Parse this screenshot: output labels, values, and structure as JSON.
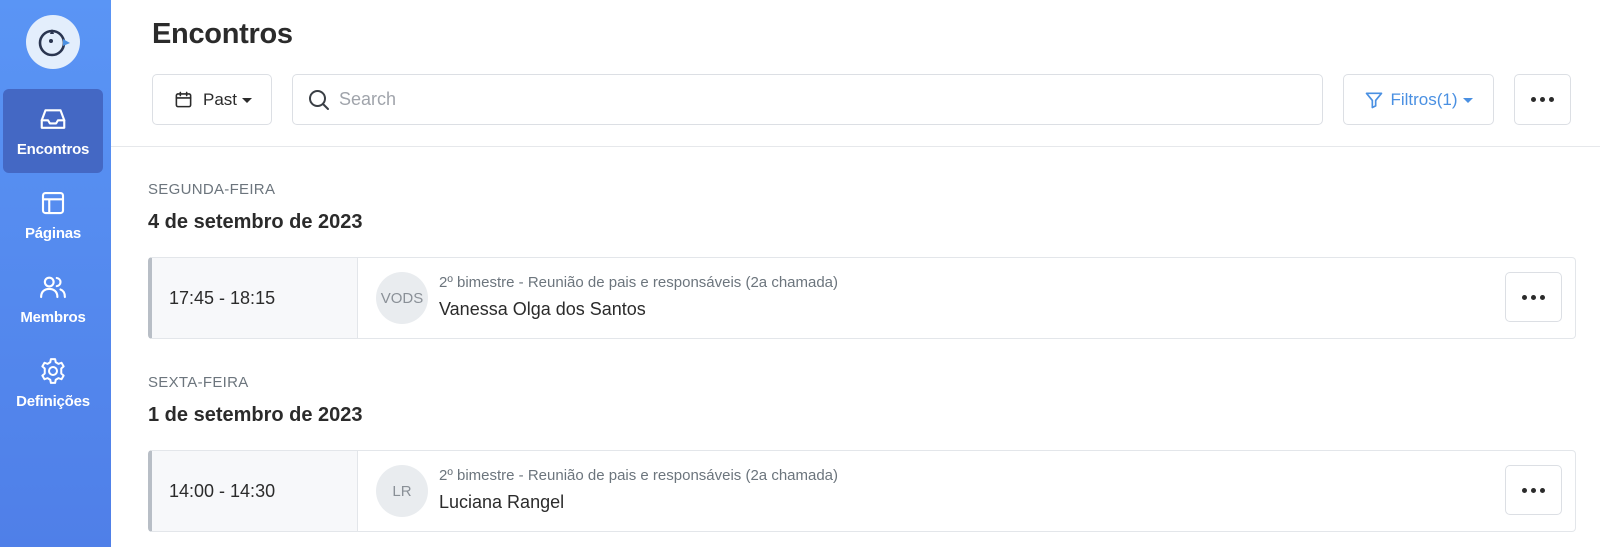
{
  "sidebar": {
    "logo_icon": "bird-logo-icon",
    "items": [
      {
        "label": "Encontros",
        "icon": "inbox-icon",
        "active": true
      },
      {
        "label": "Páginas",
        "icon": "layout-icon",
        "active": false
      },
      {
        "label": "Membros",
        "icon": "users-icon",
        "active": false
      },
      {
        "label": "Definições",
        "icon": "gear-icon",
        "active": false
      }
    ]
  },
  "header": {
    "title": "Encontros",
    "period_label": "Past",
    "search_placeholder": "Search",
    "filter_label": "Filtros(1)"
  },
  "days": [
    {
      "weekday": "SEGUNDA-FEIRA",
      "date": "4 de setembro de 2023",
      "events": [
        {
          "time": "17:45 - 18:15",
          "initials": "VODS",
          "title": "2º bimestre - Reunião de pais e responsáveis (2a chamada)",
          "person": "Vanessa Olga dos Santos"
        }
      ]
    },
    {
      "weekday": "SEXTA-FEIRA",
      "date": "1 de setembro de 2023",
      "events": [
        {
          "time": "14:00 - 14:30",
          "initials": "LR",
          "title": "2º bimestre - Reunião de pais e responsáveis (2a chamada)",
          "person": "Luciana Rangel"
        }
      ]
    }
  ],
  "colors": {
    "sidebar_top": "#5a95f5",
    "sidebar_bottom": "#4f7fe8",
    "active_nav": "#4468c4",
    "filter_accent": "#4a90e2"
  }
}
